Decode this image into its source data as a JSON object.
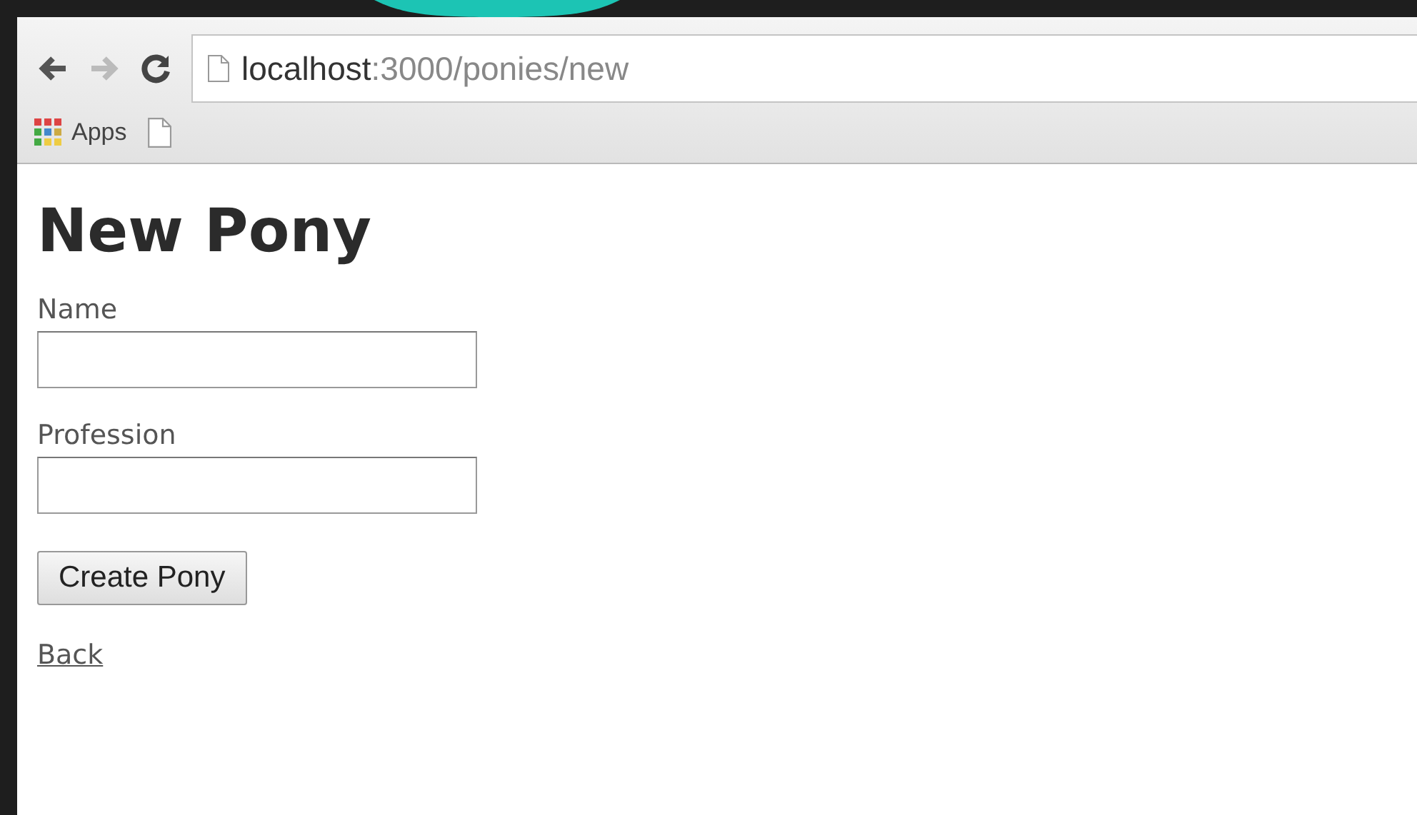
{
  "browser": {
    "url_host": "localhost",
    "url_path": ":3000/ponies/new",
    "bookmarks": [
      {
        "kind": "apps",
        "label": "Apps"
      },
      {
        "kind": "page"
      }
    ]
  },
  "page": {
    "title": "New Pony",
    "fields": [
      {
        "label": "Name"
      },
      {
        "label": "Profession"
      }
    ],
    "submit": "Create Pony",
    "back_link": "Back"
  }
}
